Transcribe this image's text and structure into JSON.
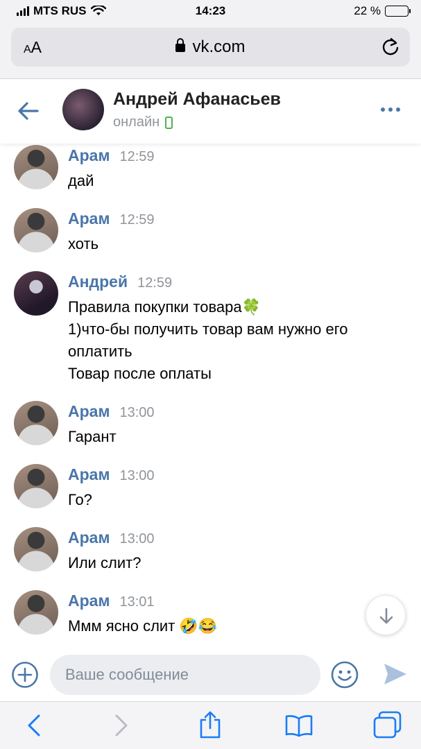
{
  "status_bar": {
    "carrier": "MTS RUS",
    "time": "14:23",
    "battery": "22 %",
    "battery_level": 0.22
  },
  "browser": {
    "text_size_label": "AA",
    "url": "vk.com"
  },
  "chat": {
    "name": "Андрей Афанасьев",
    "status": "онлайн"
  },
  "messages": [
    {
      "author": "Арам",
      "time": "12:59",
      "text": "дай",
      "avatar": "aram"
    },
    {
      "author": "Арам",
      "time": "12:59",
      "text": "хоть",
      "avatar": "aram"
    },
    {
      "author": "Андрей",
      "time": "12:59",
      "text": "Правила покупки товара🍀\n1)что-бы получить товар вам нужно его оплатить\nТовар после оплаты",
      "avatar": "andrey"
    },
    {
      "author": "Арам",
      "time": "13:00",
      "text": "Гарант",
      "avatar": "aram"
    },
    {
      "author": "Арам",
      "time": "13:00",
      "text": "Го?",
      "avatar": "aram"
    },
    {
      "author": "Арам",
      "time": "13:00",
      "text": "Или слит?",
      "avatar": "aram"
    },
    {
      "author": "Арам",
      "time": "13:01",
      "text": "Ммм ясно слит 🤣😂",
      "avatar": "aram"
    }
  ],
  "composer": {
    "placeholder": "Ваше сообщение"
  },
  "colors": {
    "accent": "#4a76a8",
    "online": "#4bb34b",
    "safari_blue": "#1a7cf5"
  }
}
